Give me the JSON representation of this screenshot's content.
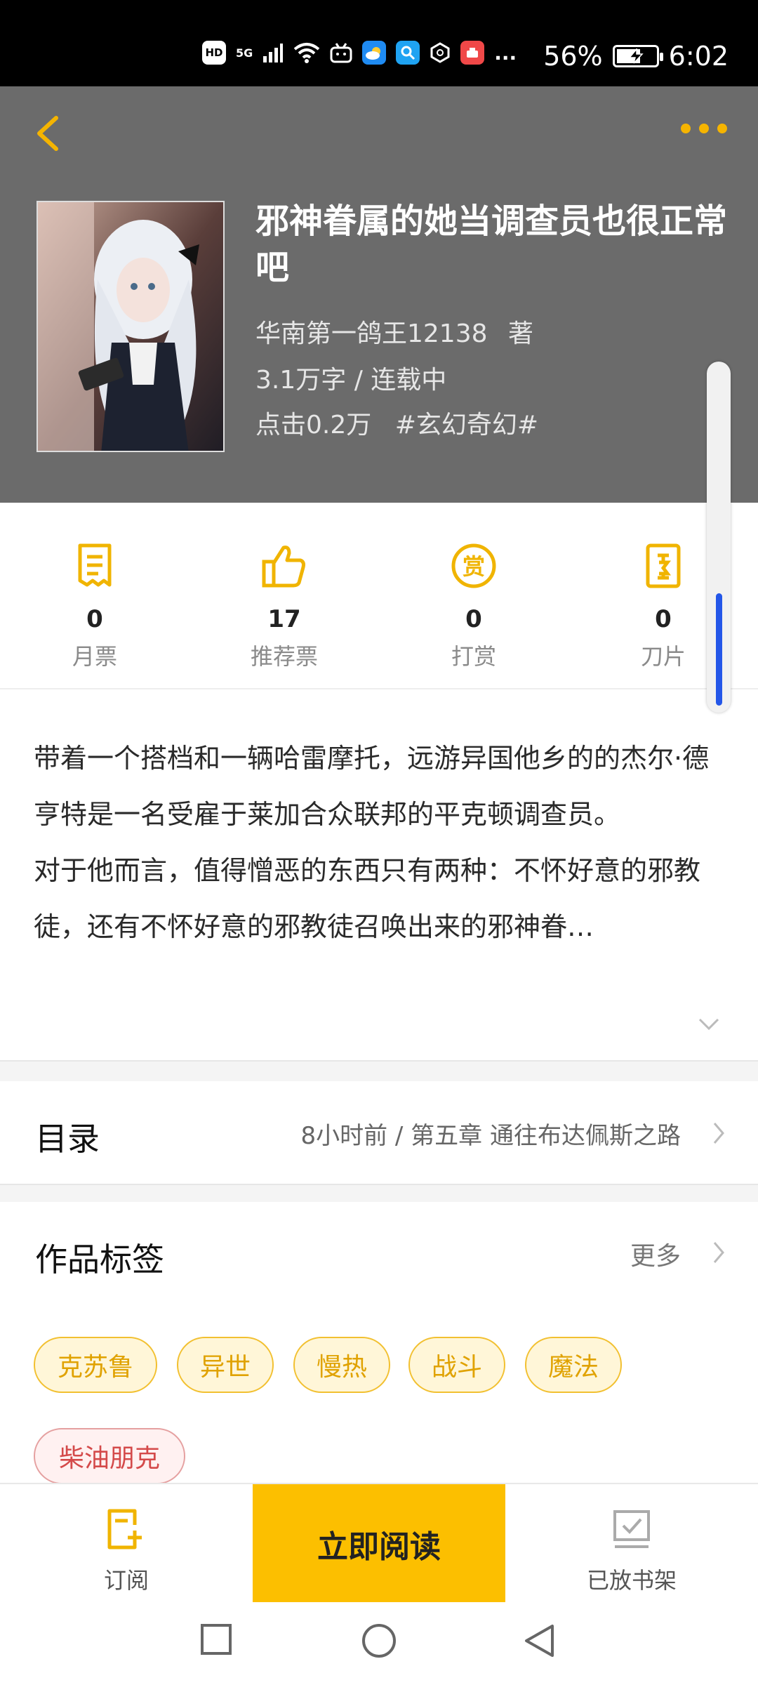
{
  "status": {
    "left_icons": [
      "HD",
      "5G",
      "signal-icon",
      "wifi-icon",
      "bilibili-icon",
      "weather-icon",
      "search-app-icon",
      "hexagon-app-icon",
      "app-icon",
      "..."
    ],
    "battery": "56%",
    "time": "6:02"
  },
  "header": {
    "back_icon": "chevron-left-icon",
    "more_icon": "more-dots-icon"
  },
  "book": {
    "title": "邪神眷属的她当调查员也很正常吧",
    "author": "华南第一鸽王12138",
    "author_suffix": "著",
    "words_status": "3.1万字 / 连载中",
    "clicks": "点击0.2万",
    "genre": "#玄幻奇幻#"
  },
  "stats": [
    {
      "icon": "ticket-icon",
      "value": "0",
      "label": "月票"
    },
    {
      "icon": "thumbs-up-icon",
      "value": "17",
      "label": "推荐票"
    },
    {
      "icon": "reward-icon",
      "value": "0",
      "label": "打赏"
    },
    {
      "icon": "blade-icon",
      "value": "0",
      "label": "刀片"
    }
  ],
  "description": {
    "p1": "带着一个搭档和一辆哈雷摩托，远游异国他乡的的杰尔·德亨特是一名受雇于莱加合众联邦的平克顿调查员。",
    "p2": "对于他而言，值得憎恶的东西只有两种：不怀好意的邪教徒，还有不怀好意的邪教徒召唤出来的邪神眷…"
  },
  "catalog": {
    "title": "目录",
    "latest": "8小时前 / 第五章 通往布达佩斯之路"
  },
  "tags": {
    "title": "作品标签",
    "more": "更多",
    "items": [
      "克苏鲁",
      "异世",
      "慢热",
      "战斗",
      "魔法",
      "柴油朋克"
    ]
  },
  "bottom": {
    "subscribe": "订阅",
    "read_now": "立即阅读",
    "on_shelf": "已放书架"
  },
  "colors": {
    "accent": "#fcbf00",
    "header_bg": "#6b6b6b",
    "scroll_thumb": "#2356e8"
  }
}
